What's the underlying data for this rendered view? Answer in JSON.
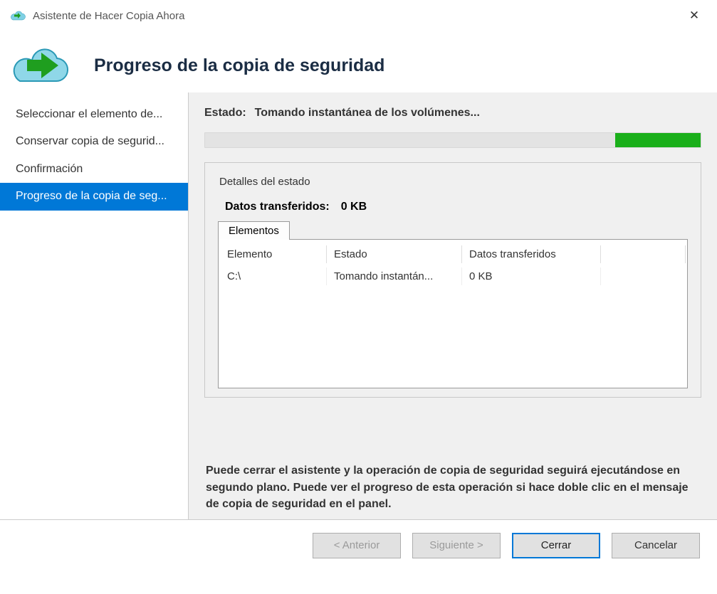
{
  "window": {
    "title": "Asistente de Hacer Copia Ahora"
  },
  "header": {
    "heading": "Progreso de la copia de seguridad"
  },
  "sidebar": {
    "items": [
      {
        "label": "Seleccionar el elemento de..."
      },
      {
        "label": "Conservar copia de segurid..."
      },
      {
        "label": "Confirmación"
      },
      {
        "label": "Progreso de la copia de seg..."
      }
    ]
  },
  "status": {
    "label": "Estado:",
    "value": "Tomando instantánea de los volúmenes..."
  },
  "details": {
    "legend": "Detalles del estado",
    "transferred_label": "Datos transferidos:",
    "transferred_value": "0 KB",
    "tab_label": "Elementos",
    "columns": {
      "c1": "Elemento",
      "c2": "Estado",
      "c3": "Datos transferidos"
    },
    "rows": [
      {
        "c1": "C:\\",
        "c2": "Tomando instantán...",
        "c3": "0 KB"
      }
    ]
  },
  "note": "Puede cerrar el asistente y la operación de copia de seguridad seguirá ejecutándose en segundo plano. Puede ver el progreso de esta operación si hace doble clic en el mensaje de copia de seguridad en el panel.",
  "footer": {
    "prev": "< Anterior",
    "next": "Siguiente >",
    "close": "Cerrar",
    "cancel": "Cancelar"
  }
}
